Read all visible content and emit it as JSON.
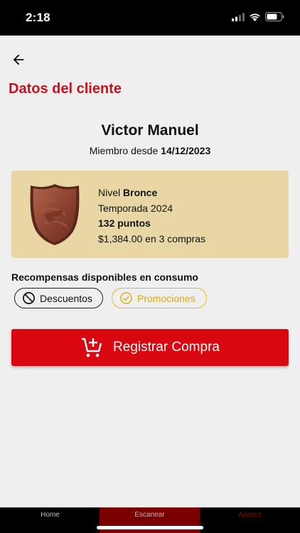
{
  "status_bar": {
    "time": "2:18"
  },
  "header": {
    "title": "Datos del cliente"
  },
  "customer": {
    "name": "Victor Manuel",
    "member_since_label": "Miembro desde",
    "member_since_date": "14/12/2023"
  },
  "level_card": {
    "level_label": "Nivel",
    "level_name": "Bronce",
    "season": "Temporada 2024",
    "points": "132 puntos",
    "purchases": "$1,384.00 en 3 compras"
  },
  "rewards": {
    "title": "Recompensas disponibles en consumo",
    "chips": [
      {
        "label": "Descuentos",
        "icon": "block-icon",
        "color": "#111111"
      },
      {
        "label": "Promociones",
        "icon": "check-circle-icon",
        "color": "#d9a81b"
      }
    ]
  },
  "register_button": {
    "label": "Registrar Compra",
    "icon": "add-cart-icon"
  },
  "bottom_nav": {
    "items": [
      {
        "label": "Home"
      },
      {
        "label": "Escanear"
      },
      {
        "label": "Ajustes"
      }
    ]
  },
  "colors": {
    "accent": "#c8121b",
    "button": "#d9070f",
    "card": "#e8d7a4",
    "nav_active": "#7a0000"
  }
}
